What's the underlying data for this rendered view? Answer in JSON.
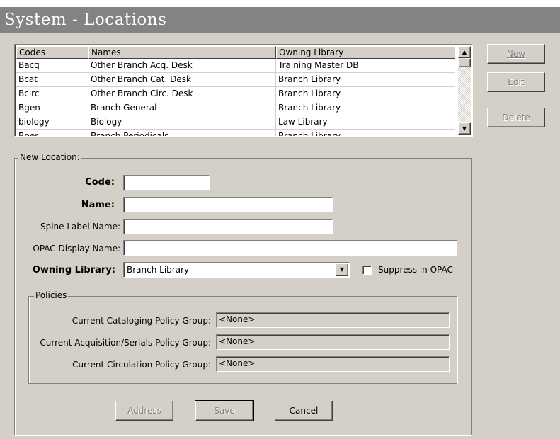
{
  "window": {
    "title": "System - Locations"
  },
  "table": {
    "columns": [
      "Codes",
      "Names",
      "Owning Library"
    ],
    "rows": [
      [
        "Bacq",
        "Other Branch Acq. Desk",
        "Training Master DB"
      ],
      [
        "Bcat",
        "Other Branch Cat. Desk",
        "Branch Library"
      ],
      [
        "Bcirc",
        "Other Branch Circ. Desk",
        "Branch Library"
      ],
      [
        "Bgen",
        "Branch General",
        "Branch Library"
      ],
      [
        "biology",
        "Biology",
        "Law Library"
      ],
      [
        "Bper",
        "Branch Periodicals",
        "Branch Library"
      ]
    ]
  },
  "side_buttons": {
    "new": "New",
    "edit": "Edit",
    "delete": "Delete"
  },
  "new_location": {
    "group_label": "New Location:",
    "code_label": "Code:",
    "code_value": "",
    "name_label": "Name:",
    "name_value": "",
    "spine_label": "Spine Label Name:",
    "spine_value": "",
    "opac_label": "OPAC Display Name:",
    "opac_value": "",
    "owning_label": "Owning Library:",
    "owning_value": "Branch Library",
    "suppress_label": "Suppress in OPAC"
  },
  "policies": {
    "group_label": "Policies",
    "cataloging_label": "Current Cataloging Policy Group:",
    "cataloging_value": "<None>",
    "acquisition_label": "Current Acquisition/Serials Policy Group:",
    "acquisition_value": "<None>",
    "circulation_label": "Current Circulation Policy Group:",
    "circulation_value": "<None>"
  },
  "bottom_buttons": {
    "address": "Address",
    "save": "Save",
    "cancel": "Cancel"
  }
}
